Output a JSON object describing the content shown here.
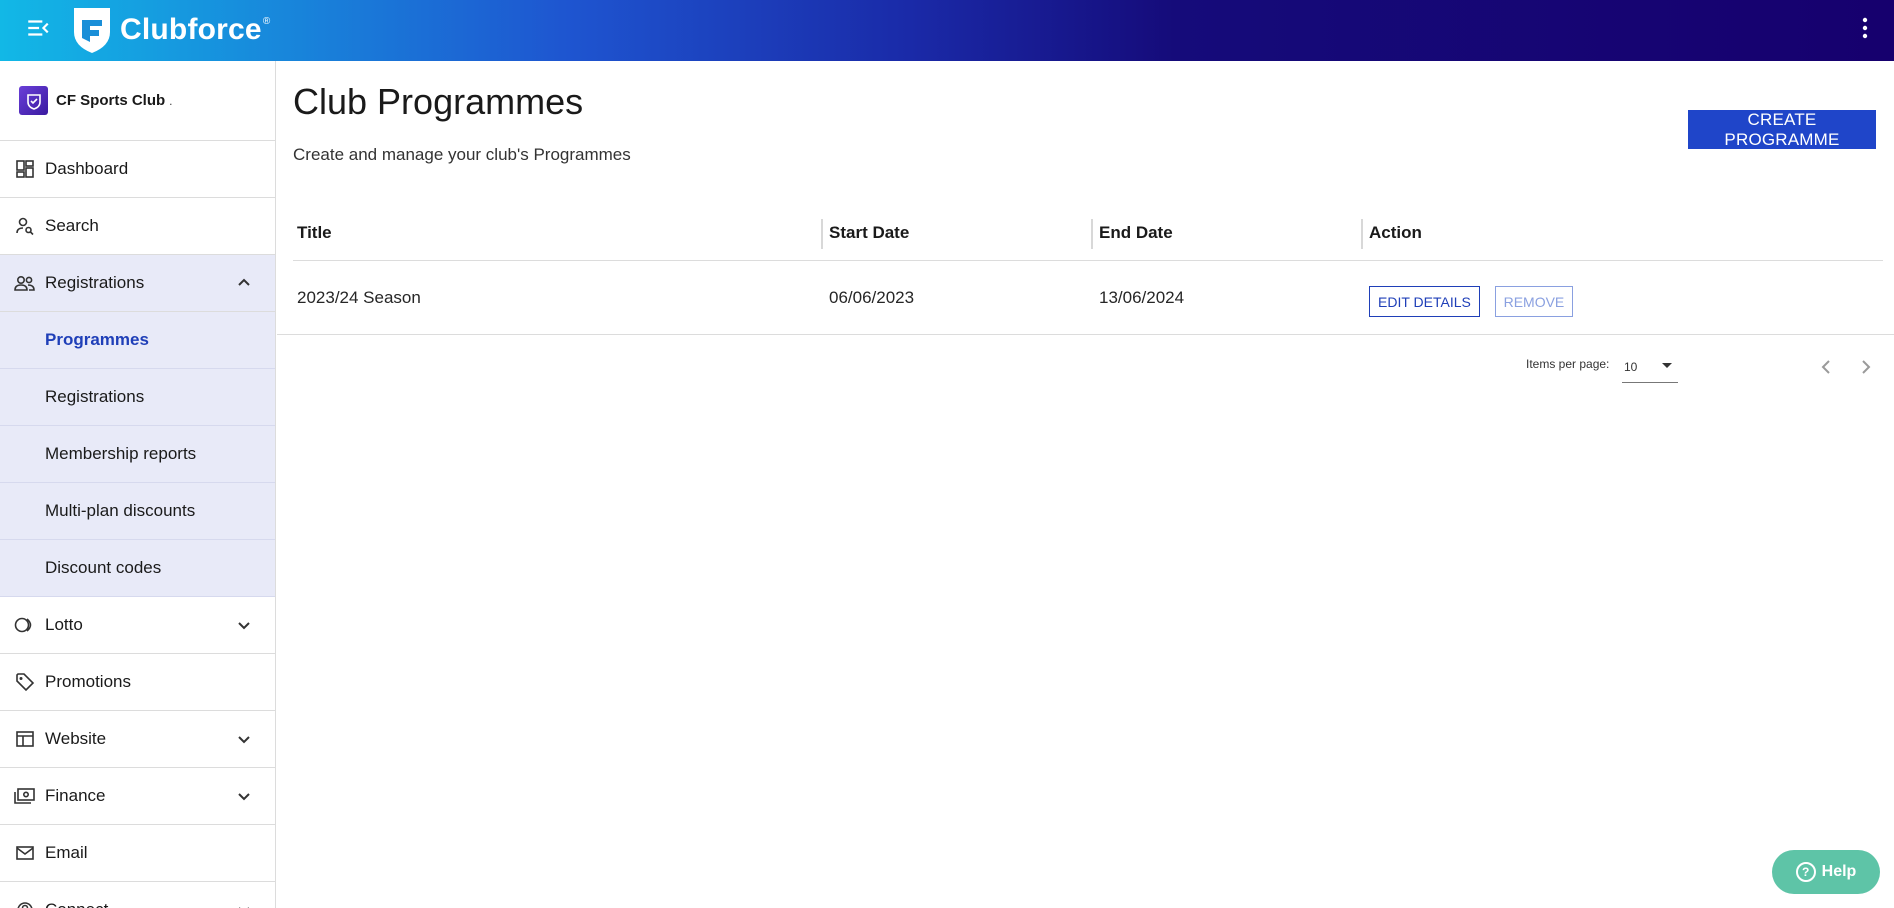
{
  "app": {
    "name": "Clubforce",
    "reg_mark": "®"
  },
  "club": {
    "name": "CF Sports Club",
    "suffix": "."
  },
  "sidebar": {
    "items": [
      {
        "label": "Dashboard",
        "icon": "dashboard-icon"
      },
      {
        "label": "Search",
        "icon": "person-search-icon"
      },
      {
        "label": "Registrations",
        "icon": "people-icon",
        "expanded": true,
        "children": [
          {
            "label": "Programmes",
            "active": true
          },
          {
            "label": "Registrations"
          },
          {
            "label": "Membership reports"
          },
          {
            "label": "Multi-plan discounts"
          },
          {
            "label": "Discount codes"
          }
        ]
      },
      {
        "label": "Lotto",
        "icon": "lotto-icon",
        "expandable": true
      },
      {
        "label": "Promotions",
        "icon": "tag-icon"
      },
      {
        "label": "Website",
        "icon": "website-icon",
        "expandable": true
      },
      {
        "label": "Finance",
        "icon": "payments-icon",
        "expandable": true
      },
      {
        "label": "Email",
        "icon": "mail-icon"
      },
      {
        "label": "Connect",
        "icon": "connect-icon",
        "expandable": true
      }
    ]
  },
  "main": {
    "title": "Club Programmes",
    "subtitle": "Create and manage your club's Programmes",
    "create_label": "CREATE PROGRAMME",
    "table": {
      "headers": [
        "Title",
        "Start Date",
        "End Date",
        "Action"
      ],
      "rows": [
        {
          "title": "2023/24 Season",
          "start": "06/06/2023",
          "end": "13/06/2024",
          "edit_label": "EDIT DETAILS",
          "remove_label": "REMOVE"
        }
      ]
    },
    "pagination": {
      "items_per_page_label": "Items per page:",
      "items_per_page": "10"
    }
  },
  "help": {
    "label": "Help"
  },
  "colors": {
    "accent": "#1f45c9",
    "help": "#5ec4a7",
    "active_bg": "#e8eaf8"
  }
}
